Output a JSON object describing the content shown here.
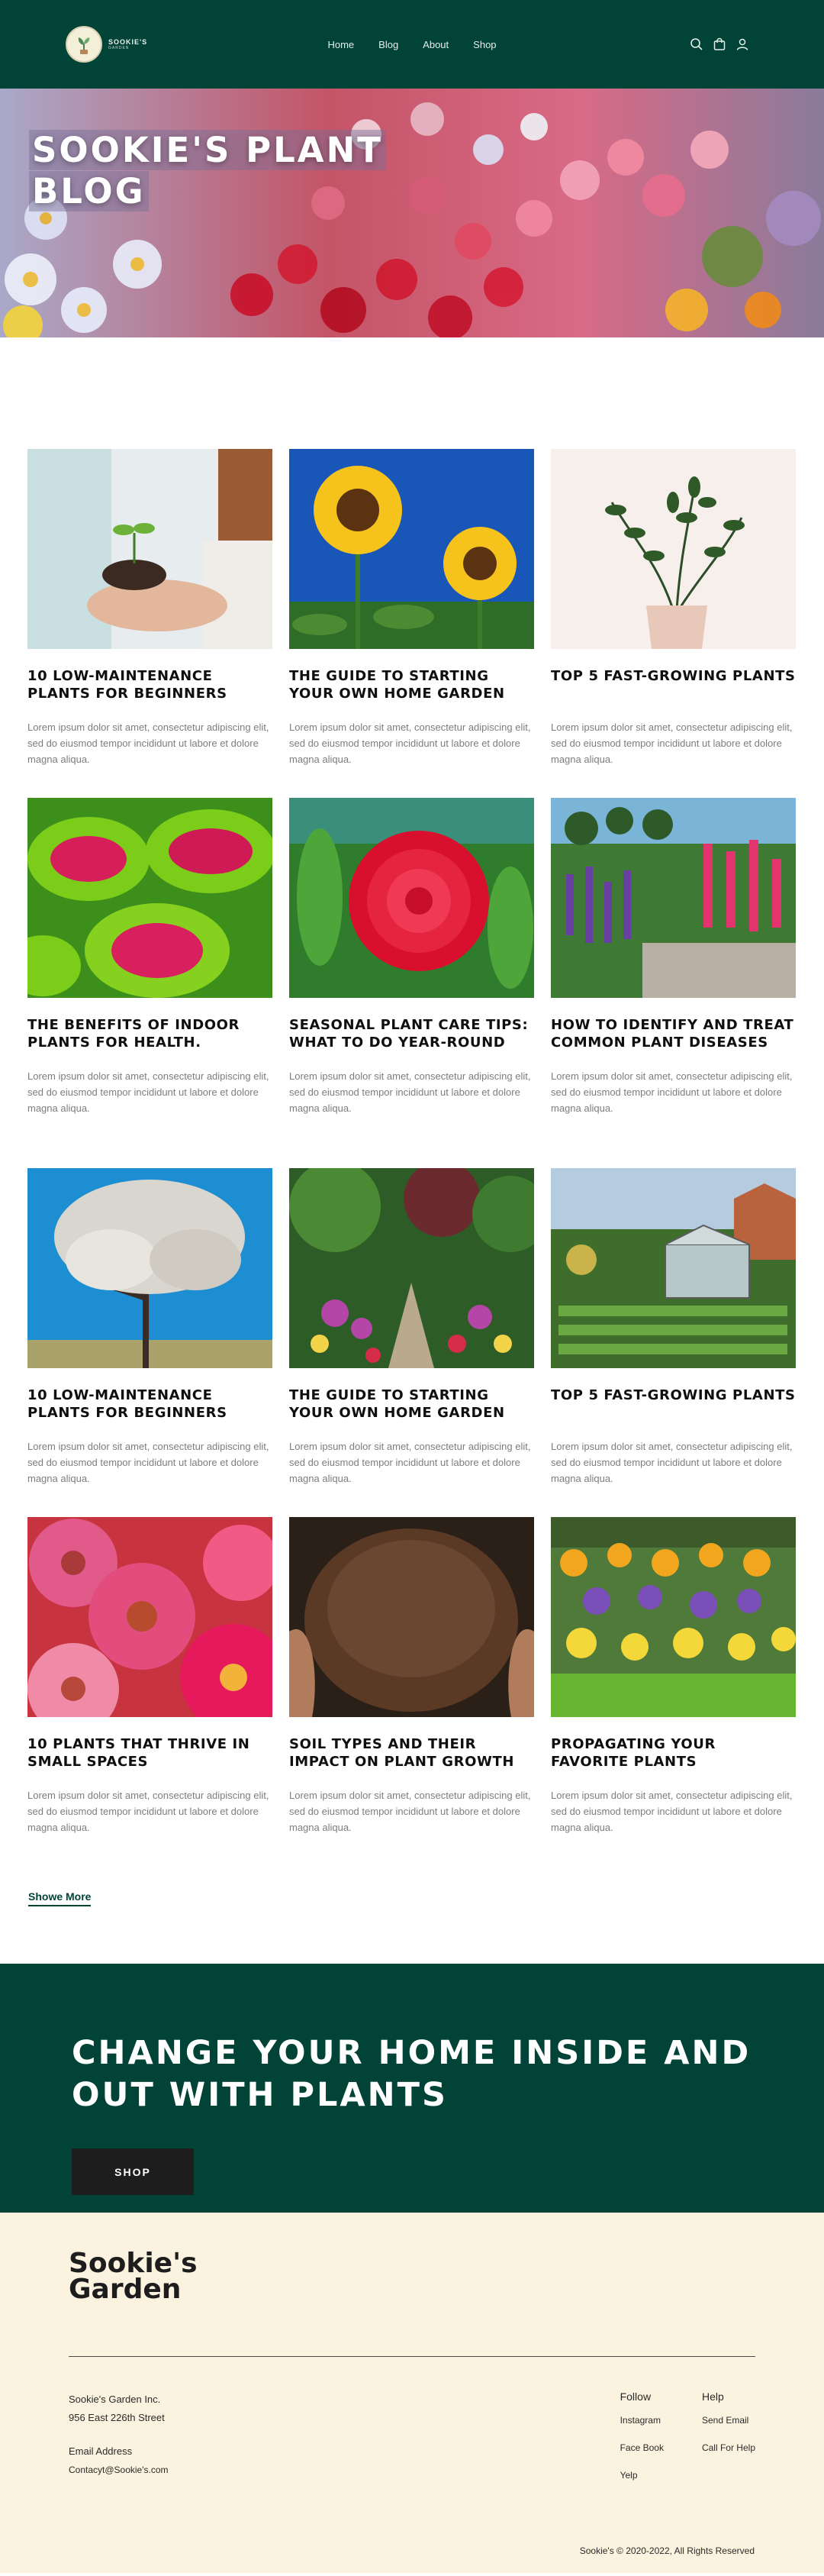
{
  "nav": {
    "logo_text": "SOOKIE'S",
    "logo_sub": "GARDEN",
    "links": [
      "Home",
      "Blog",
      "About",
      "Shop"
    ],
    "icons": [
      "search-icon",
      "cart-icon",
      "user-icon"
    ]
  },
  "hero": {
    "title_line1": "SOOKIE'S PLANT",
    "title_line2": "BLOG"
  },
  "posts": [
    {
      "title": "10 LOW-MAINTENANCE PLANTS FOR BEGINNERS",
      "excerpt": "Lorem ipsum dolor sit amet, consectetur adipiscing elit, sed do eiusmod tempor incididunt ut labore et dolore magna aliqua."
    },
    {
      "title": "THE  GUIDE TO STARTING YOUR OWN HOME GARDEN",
      "excerpt": "Lorem ipsum dolor sit amet, consectetur adipiscing elit, sed do eiusmod tempor incididunt ut labore et dolore magna aliqua."
    },
    {
      "title": "TOP 5 FAST-GROWING PLANTS",
      "excerpt": "Lorem ipsum dolor sit amet, consectetur adipiscing elit, sed do eiusmod tempor incididunt ut labore et dolore magna aliqua."
    },
    {
      "title": "THE BENEFITS OF INDOOR PLANTS FOR  HEALTH.",
      "excerpt": "Lorem ipsum dolor sit amet, consectetur adipiscing elit, sed do eiusmod tempor incididunt ut labore et dolore magna aliqua."
    },
    {
      "title": "SEASONAL PLANT CARE TIPS: WHAT TO DO YEAR-ROUND",
      "excerpt": "Lorem ipsum dolor sit amet, consectetur adipiscing elit, sed do eiusmod tempor incididunt ut labore et dolore magna aliqua."
    },
    {
      "title": "HOW TO IDENTIFY AND TREAT COMMON PLANT DISEASES",
      "excerpt": "Lorem ipsum dolor sit amet, consectetur adipiscing elit, sed do eiusmod tempor incididunt ut labore et dolore magna aliqua."
    },
    {
      "title": "10 LOW-MAINTENANCE PLANTS FOR BEGINNERS",
      "excerpt": "Lorem ipsum dolor sit amet, consectetur adipiscing elit, sed do eiusmod tempor incididunt ut labore et dolore magna aliqua."
    },
    {
      "title": "THE  GUIDE TO STARTING YOUR OWN HOME GARDEN",
      "excerpt": "Lorem ipsum dolor sit amet, consectetur adipiscing elit, sed do eiusmod tempor incididunt ut labore et dolore magna aliqua."
    },
    {
      "title": "TOP 5 FAST-GROWING PLANTS",
      "excerpt": "Lorem ipsum dolor sit amet, consectetur adipiscing elit, sed do eiusmod tempor incididunt ut labore et dolore magna aliqua."
    },
    {
      "title": "10 PLANTS THAT THRIVE IN SMALL SPACES",
      "excerpt": "Lorem ipsum dolor sit amet, consectetur adipiscing elit, sed do eiusmod tempor incididunt ut labore et dolore magna aliqua."
    },
    {
      "title": " SOIL TYPES AND THEIR IMPACT ON PLANT GROWTH",
      "excerpt": "Lorem ipsum dolor sit amet, consectetur adipiscing elit, sed do eiusmod tempor incididunt ut labore et dolore magna aliqua."
    },
    {
      "title": " PROPAGATING YOUR FAVORITE PLANTS",
      "excerpt": "Lorem ipsum dolor sit amet, consectetur adipiscing elit, sed do eiusmod tempor incididunt ut labore et dolore magna aliqua."
    }
  ],
  "show_more": "Showe More",
  "cta": {
    "title_line1": "CHANGE YOUR  HOME INSIDE AND",
    "title_line2": "OUT WITH PLANTS",
    "button": "SHOP"
  },
  "footer": {
    "brand_line1": "Sookie's",
    "brand_line2": "Garden",
    "company": "Sookie's Garden Inc.",
    "street": "956 East 226th Street",
    "email_label": "Email Address",
    "email": "Contacyt@Sookie's.com",
    "follow": {
      "heading": "Follow",
      "links": [
        "Instagram",
        "Face Book",
        "Yelp"
      ]
    },
    "help": {
      "heading": "Help",
      "links": [
        "Send Email",
        "Call For Help"
      ]
    },
    "copyright": "Sookie's © 2020-2022, All Rights Reserved"
  },
  "colors": {
    "primary": "#014337",
    "footer_bg": "#fbf3df",
    "button": "#1d1d1d"
  }
}
